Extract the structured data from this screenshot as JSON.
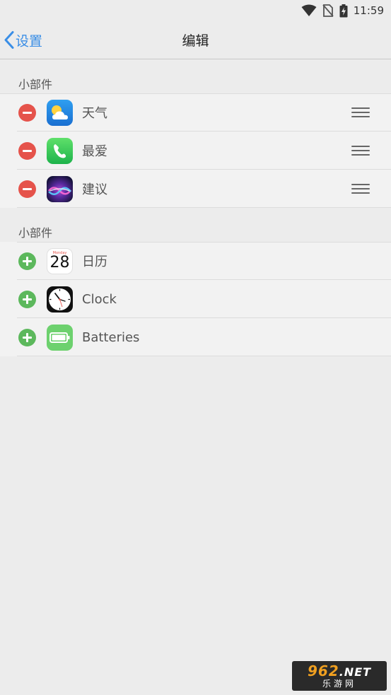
{
  "status_bar": {
    "time": "11:59"
  },
  "nav": {
    "back_label": "设置",
    "title": "编辑"
  },
  "sections": [
    {
      "header": "小部件",
      "items": [
        {
          "label": "天气",
          "action": "remove",
          "icon": "weather-icon"
        },
        {
          "label": "最爱",
          "action": "remove",
          "icon": "phone-icon"
        },
        {
          "label": "建议",
          "action": "remove",
          "icon": "siri-icon"
        }
      ]
    },
    {
      "header": "小部件",
      "items": [
        {
          "label": "日历",
          "action": "add",
          "icon": "calendar-icon"
        },
        {
          "label": "Clock",
          "action": "add",
          "icon": "clock-icon"
        },
        {
          "label": "Batteries",
          "action": "add",
          "icon": "battery-icon"
        }
      ]
    }
  ],
  "calendar_icon": {
    "weekday": "Monday",
    "day": "28"
  },
  "watermark": {
    "top": "962",
    "net": ".NET",
    "bottom": "乐游网"
  },
  "colors": {
    "accent": "#3a8ee6",
    "remove": "#e5534b",
    "add": "#5cb85c"
  }
}
